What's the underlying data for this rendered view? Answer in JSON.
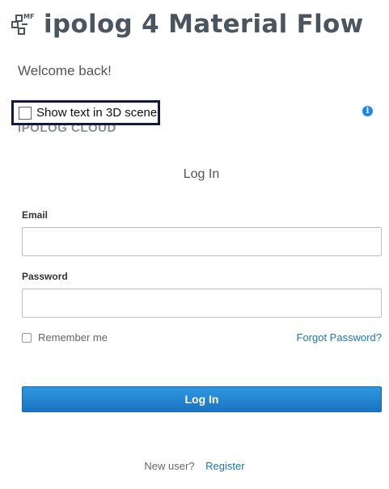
{
  "header": {
    "logo_icon": "ipolog-mf-logo-icon",
    "logo_badge": "MF",
    "title": "ipolog 4 Material Flow"
  },
  "welcome": "Welcome back!",
  "scene_toggle": {
    "label": "Show text in 3D scene",
    "checked": false
  },
  "info_icon": "info-icon",
  "brand": "IPOLOG CLOUD",
  "login": {
    "title": "Log In",
    "email_label": "Email",
    "email_value": "",
    "password_label": "Password",
    "password_value": "",
    "remember_label": "Remember me",
    "remember_checked": false,
    "forgot_label": "Forgot Password?",
    "submit_label": "Log In",
    "new_user_text": "New user?",
    "register_label": "Register"
  },
  "colors": {
    "title": "#4a5560",
    "accent": "#1b75bc",
    "button": "#2185d0",
    "toggle_border": "#131a3a"
  }
}
